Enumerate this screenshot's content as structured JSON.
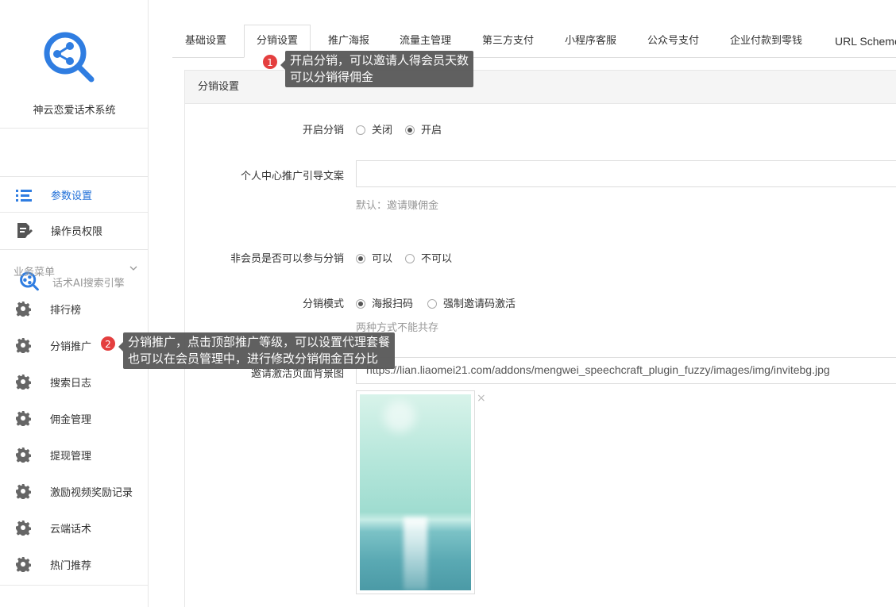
{
  "sidebar": {
    "brand_name": "神云恋爱话术系统",
    "product_name": "话术AI搜索引擎",
    "nav": [
      {
        "label": "参数设置",
        "icon": "list-icon",
        "active": true
      },
      {
        "label": "操作员权限",
        "icon": "document-edit-icon",
        "active": false
      }
    ],
    "group_title": "业务菜单",
    "menu": [
      {
        "label": "排行榜"
      },
      {
        "label": "分销推广"
      },
      {
        "label": "搜索日志"
      },
      {
        "label": "佣金管理"
      },
      {
        "label": "提现管理"
      },
      {
        "label": "激励视频奖励记录"
      },
      {
        "label": "云端话术"
      },
      {
        "label": "热门推荐"
      }
    ]
  },
  "tabs": [
    {
      "label": "基础设置"
    },
    {
      "label": "分销设置"
    },
    {
      "label": "推广海报"
    },
    {
      "label": "流量主管理"
    },
    {
      "label": "第三方支付"
    },
    {
      "label": "小程序客服"
    },
    {
      "label": "公众号支付"
    },
    {
      "label": "企业付款到零钱"
    },
    {
      "label": "URL Scheme"
    }
  ],
  "panel": {
    "title": "分销设置",
    "enable": {
      "label": "开启分销",
      "options": [
        "关闭",
        "开启"
      ],
      "selected": 1
    },
    "guide_text": {
      "label": "个人中心推广引导文案",
      "value": "",
      "help": "默认：邀请赚佣金"
    },
    "non_member": {
      "label": "非会员是否可以参与分销",
      "options": [
        "可以",
        "不可以"
      ],
      "selected": 0
    },
    "mode": {
      "label": "分销模式",
      "options": [
        "海报扫码",
        "强制邀请码激活"
      ],
      "selected": 0,
      "help": "两种方式不能共存"
    },
    "bg_image": {
      "label": "邀请激活页面背景图",
      "value": "https://lian.liaomei21.com/addons/mengwei_speechcraft_plugin_fuzzy/images/img/invitebg.jpg",
      "remove": "×"
    }
  },
  "annotations": [
    {
      "number": "1",
      "lines": [
        "开启分销，可以邀请人得会员天数",
        "可以分销得佣金"
      ]
    },
    {
      "number": "2",
      "lines": [
        "分销推广，点击顶部推广等级，可以设置代理套餐",
        "也可以在会员管理中，进行修改分销佣金百分比"
      ]
    }
  ],
  "colors": {
    "accent": "#1f6fd8",
    "logo": "#2f7de1",
    "badge": "#e43f3f",
    "tooltip": "#5a5a5a"
  }
}
